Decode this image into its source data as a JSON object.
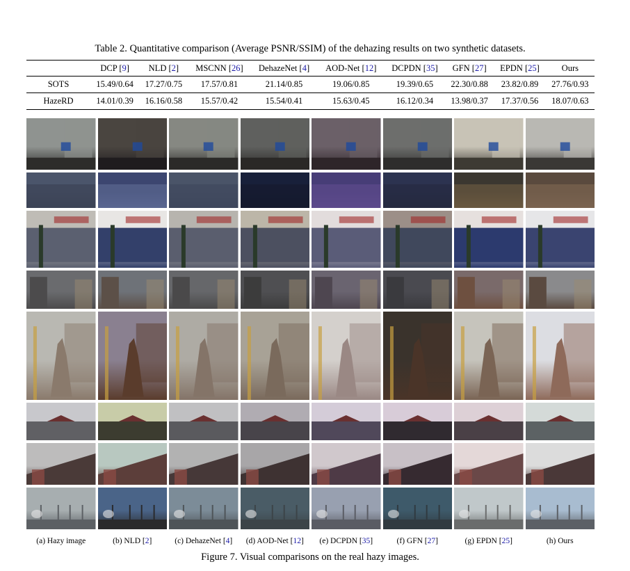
{
  "table": {
    "caption": "Table 2. Quantitative comparison (Average PSNR/SSIM) of the dehazing results on two synthetic datasets.",
    "headers": [
      {
        "name": "",
        "ref": ""
      },
      {
        "name": "DCP",
        "ref": "9"
      },
      {
        "name": "NLD",
        "ref": "2"
      },
      {
        "name": "MSCNN",
        "ref": "26"
      },
      {
        "name": "DehazeNet",
        "ref": "4"
      },
      {
        "name": "AOD-Net",
        "ref": "12"
      },
      {
        "name": "DCPDN",
        "ref": "35"
      },
      {
        "name": "GFN",
        "ref": "27"
      },
      {
        "name": "EPDN",
        "ref": "25"
      },
      {
        "name": "Ours",
        "ref": ""
      }
    ],
    "rows": [
      {
        "dataset": "SOTS",
        "values": [
          "15.49/0.64",
          "17.27/0.75",
          "17.57/0.81",
          "21.14/0.85",
          "19.06/0.85",
          "19.39/0.65",
          "22.30/0.88",
          "23.82/0.89",
          "27.76/0.93"
        ]
      },
      {
        "dataset": "HazeRD",
        "values": [
          "14.01/0.39",
          "16.16/0.58",
          "15.57/0.42",
          "15.54/0.41",
          "15.63/0.45",
          "16.12/0.34",
          "13.98/0.37",
          "17.37/0.56",
          "18.07/0.63"
        ]
      }
    ]
  },
  "figure": {
    "subfigure_labels": [
      {
        "prefix": "(a) Hazy image",
        "ref": ""
      },
      {
        "prefix": "(b) NLD ",
        "ref": "2"
      },
      {
        "prefix": "(c) DehazeNet ",
        "ref": "4"
      },
      {
        "prefix": "(d) AOD-Net ",
        "ref": "12"
      },
      {
        "prefix": "(e) DCPDN ",
        "ref": "35"
      },
      {
        "prefix": "(f) GFN ",
        "ref": "27"
      },
      {
        "prefix": "(g) EPDN ",
        "ref": "25"
      },
      {
        "prefix": "(h) Ours",
        "ref": ""
      }
    ],
    "caption": "Figure 7. Visual comparisons on the real hazy images.",
    "scenes": [
      {
        "name": "city-street-overpass",
        "sky": [
          "#8f9390",
          "#4a4540",
          "#868882",
          "#5f605e",
          "#6b6068",
          "#6d6e6c",
          "#c8c3b6",
          "#b9b8b3"
        ],
        "ground": [
          "#2d2c2a",
          "#1f1c1e",
          "#2b2a28",
          "#2a2826",
          "#2e2529",
          "#2e2d2c",
          "#3d3a33",
          "#3a3835"
        ],
        "accent": "#1f4a9c"
      },
      {
        "name": "aerial-city",
        "sky": [
          "#4b556b",
          "#3c4670",
          "#4a5468",
          "#18203a",
          "#473d77",
          "#2c3350",
          "#3b3730",
          "#5a4a3e"
        ],
        "ground": [
          "#3c4356",
          "#5a6690",
          "#3e475c",
          "#151a2e",
          "#5c4a8c",
          "#252a40",
          "#6a5840",
          "#7a6450"
        ],
        "accent": "#9aa4c0"
      },
      {
        "name": "building-facade",
        "sky": [
          "#bfbcb6",
          "#e8e6e4",
          "#b7b4ae",
          "#bcb6a8",
          "#e2dcdc",
          "#9c8f88",
          "#e6e0de",
          "#e6e6e8"
        ],
        "ground": [
          "#5b6070",
          "#33406a",
          "#5a5e6e",
          "#4c5060",
          "#5a5c78",
          "#40485c",
          "#2c3a6e",
          "#3a4470"
        ],
        "accent": "#a02828"
      },
      {
        "name": "apartment-blocks",
        "sky": [
          "#6a6b6e",
          "#6e7278",
          "#66676a",
          "#4f4f52",
          "#6a6470",
          "#4a4a50",
          "#7a6a6a",
          "#8a8a8c"
        ],
        "ground": [
          "#4c4b4c",
          "#5c5048",
          "#4a494a",
          "#3c3c3c",
          "#4e4650",
          "#3a3a3e",
          "#6e5040",
          "#5a4a40"
        ],
        "accent": "#9a8a70"
      },
      {
        "name": "monument-statue",
        "sky": [
          "#b9b8b2",
          "#8a8090",
          "#aeaba4",
          "#a8a296",
          "#d4d0cc",
          "#3a332c",
          "#c6c4bc",
          "#dcdde2"
        ],
        "ground": [
          "#8a7a6c",
          "#5a3c2c",
          "#847468",
          "#7a6a5c",
          "#9a8884",
          "#4a3428",
          "#7a6454",
          "#8e6a5a"
        ],
        "accent": "#c8a040"
      },
      {
        "name": "palace-moat",
        "sky": [
          "#c8c8cc",
          "#c8cca8",
          "#c0c0c2",
          "#b0acb2",
          "#d4ccd8",
          "#d8ccd8",
          "#ddd0d6",
          "#d4dad8"
        ],
        "ground": [
          "#606064",
          "#3c3c30",
          "#5a5a5e",
          "#48444a",
          "#50485a",
          "#302a30",
          "#4a4046",
          "#5c6264"
        ],
        "accent": "#6a3030"
      },
      {
        "name": "gate-tower",
        "sky": [
          "#bdbcbc",
          "#b8c8c0",
          "#b2b2b2",
          "#a8a6a8",
          "#d0c8cc",
          "#c8c0c6",
          "#e4d8d8",
          "#dcdcdc"
        ],
        "ground": [
          "#4a3a38",
          "#5c3e3a",
          "#463838",
          "#3e3232",
          "#4e3a46",
          "#362a30",
          "#6a4848",
          "#4a3838"
        ],
        "accent": "#8a4a44"
      },
      {
        "name": "industrial-chimneys",
        "sky": [
          "#a7aeb0",
          "#4a6488",
          "#7c8c98",
          "#4a5c66",
          "#98a0b0",
          "#3e5a6a",
          "#c0c8ca",
          "#a8bcd0"
        ],
        "ground": [
          "#5c6064",
          "#2a2a2c",
          "#4e5458",
          "#3c4448",
          "#5a5c64",
          "#303a40",
          "#6a6c6c",
          "#5c6066"
        ],
        "accent": "#e8e8e8"
      }
    ]
  }
}
